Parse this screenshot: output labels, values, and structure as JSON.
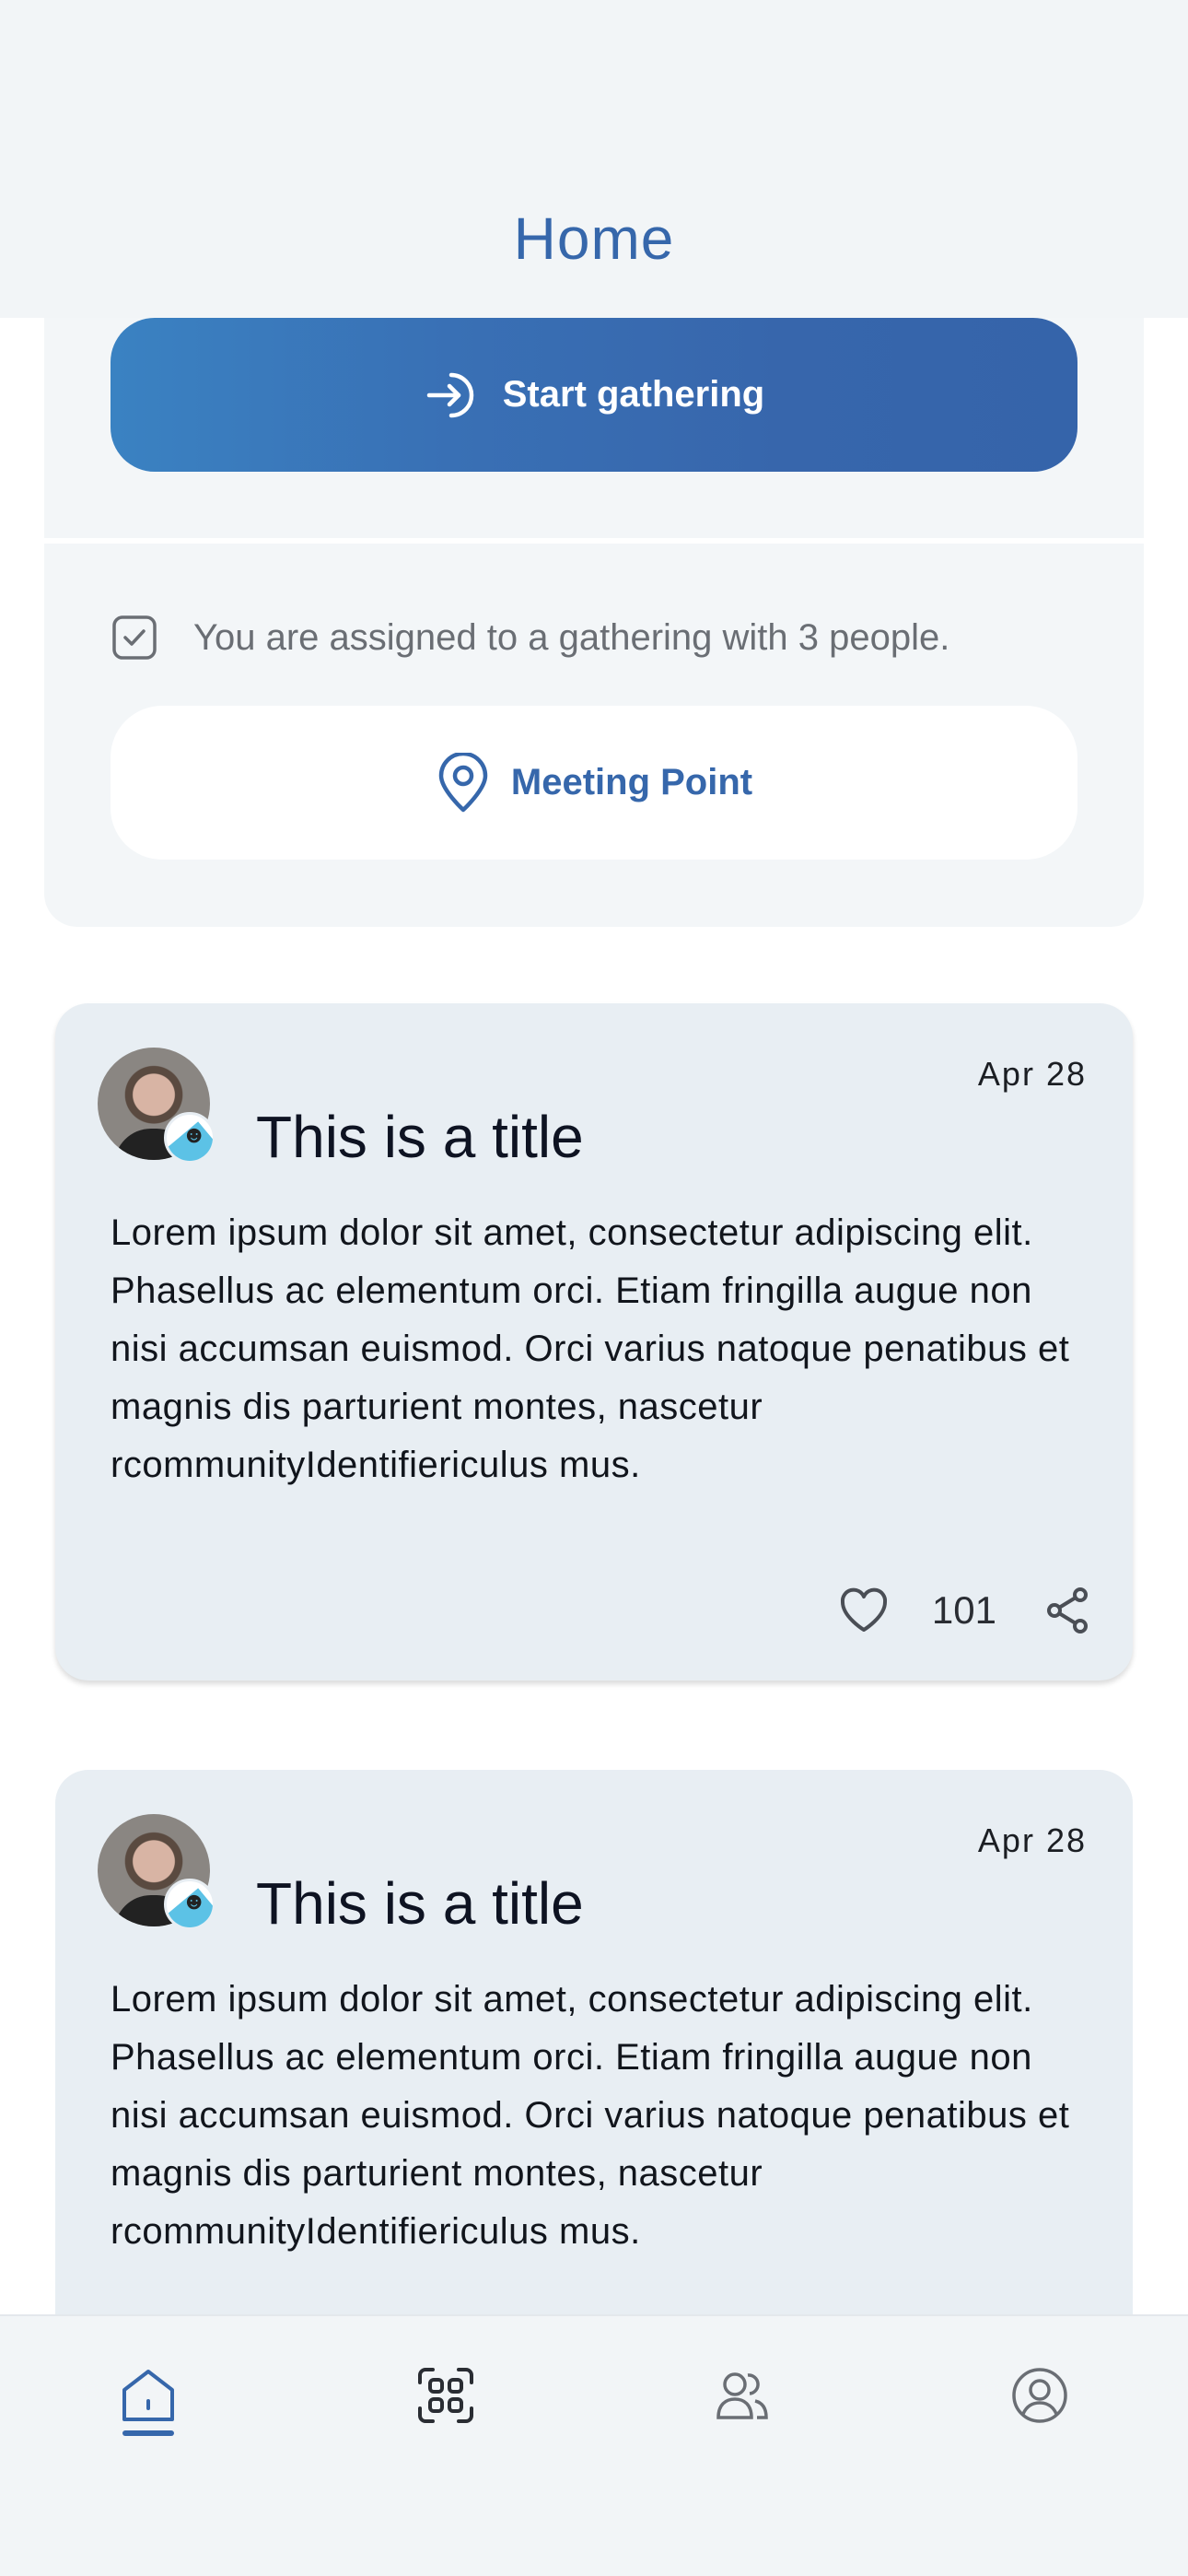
{
  "header": {
    "title": "Home"
  },
  "gathering": {
    "start_label": "Start gathering",
    "assigned_text": "You are assigned to a gathering with 3 people.",
    "meeting_point_label": "Meeting Point"
  },
  "posts": [
    {
      "date": "Apr 28",
      "title": "This is a title",
      "body": "Lorem ipsum dolor sit amet, consectetur adipiscing elit. Phasellus ac elementum orci. Etiam fringilla augue non nisi accumsan euismod. Orci varius natoque penatibus et magnis dis parturient montes, nascetur rcommunityIdentifiericulus mus.",
      "likes": "101"
    },
    {
      "date": "Apr 28",
      "title": "This is a title",
      "body": "Lorem ipsum dolor sit amet, consectetur adipiscing elit. Phasellus ac elementum orci. Etiam fringilla augue non nisi accumsan euismod. Orci varius natoque penatibus et magnis dis parturient montes, nascetur rcommunityIdentifiericulus mus."
    }
  ],
  "nav": {
    "items": [
      {
        "icon": "home-icon",
        "active": true
      },
      {
        "icon": "qr-scan-icon",
        "active": false
      },
      {
        "icon": "people-icon",
        "active": false
      },
      {
        "icon": "profile-icon",
        "active": false
      }
    ]
  },
  "colors": {
    "accent": "#3667ab",
    "header_bg": "#f2f5f7",
    "card_bg": "#e8eef3"
  }
}
